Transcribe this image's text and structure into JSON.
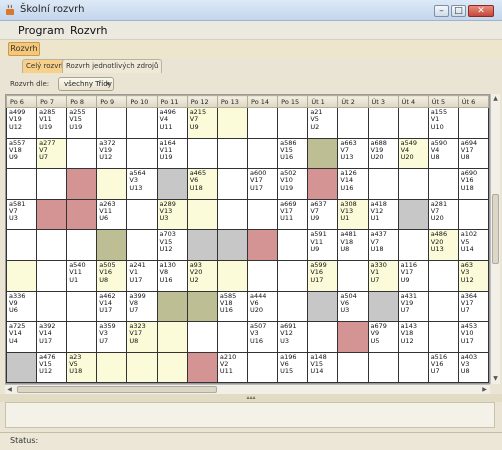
{
  "window": {
    "title": "Školní rozvrh"
  },
  "menu": [
    "Program",
    "Rozvrh"
  ],
  "toolbar": {
    "button": "Rozvrh"
  },
  "tabs": [
    "Celý rozvrh",
    "Rozvrh jednotlivých zdrojů"
  ],
  "filter": {
    "label": "Rozvrh dle:",
    "value": "všechny Třídy"
  },
  "grid": {
    "headers": [
      "Po 6",
      "Po 7",
      "Po 8",
      "Po 9",
      "Po 10",
      "Po 11",
      "Po 12",
      "Po 13",
      "Po 14",
      "Po 15",
      "Út 1",
      "Út 2",
      "Út 3",
      "Út 4",
      "Út 5",
      "Út 6"
    ],
    "rows": [
      [
        {
          "t": [
            "a499",
            "V19",
            "U12"
          ],
          "b": ""
        },
        {
          "t": [
            "a285",
            "V11",
            "U19"
          ],
          "b": ""
        },
        {
          "t": [
            "a255",
            "V15",
            "U19"
          ],
          "b": ""
        },
        {
          "t": [],
          "b": ""
        },
        {
          "t": [],
          "b": ""
        },
        {
          "t": [
            "a496",
            "V4",
            "U11"
          ],
          "b": ""
        },
        {
          "t": [
            "a215",
            "V7",
            "U9"
          ],
          "b": "y"
        },
        {
          "t": [],
          "b": "y"
        },
        {
          "t": [],
          "b": ""
        },
        {
          "t": [],
          "b": ""
        },
        {
          "t": [
            "a21",
            "V5",
            "U2"
          ],
          "b": ""
        },
        {
          "t": [],
          "b": ""
        },
        {
          "t": [],
          "b": ""
        },
        {
          "t": [],
          "b": ""
        },
        {
          "t": [
            "a155",
            "V1",
            "U10"
          ],
          "b": ""
        },
        {
          "t": [],
          "b": ""
        }
      ],
      [
        {
          "t": [
            "a557",
            "V18",
            "U9"
          ],
          "b": ""
        },
        {
          "t": [
            "a277",
            "V7",
            "U7"
          ],
          "b": "y"
        },
        {
          "t": [],
          "b": ""
        },
        {
          "t": [
            "a372",
            "V19",
            "U12"
          ],
          "b": ""
        },
        {
          "t": [],
          "b": ""
        },
        {
          "t": [
            "a164",
            "V11",
            "U19"
          ],
          "b": ""
        },
        {
          "t": [],
          "b": ""
        },
        {
          "t": [],
          "b": ""
        },
        {
          "t": [],
          "b": ""
        },
        {
          "t": [
            "a586",
            "V15",
            "U16"
          ],
          "b": ""
        },
        {
          "t": [],
          "b": "o"
        },
        {
          "t": [
            "a663",
            "V7",
            "U13"
          ],
          "b": ""
        },
        {
          "t": [
            "a688",
            "V19",
            "U20"
          ],
          "b": ""
        },
        {
          "t": [
            "a549",
            "V4",
            "U20"
          ],
          "b": "y"
        },
        {
          "t": [
            "a590",
            "V4",
            "U8"
          ],
          "b": ""
        },
        {
          "t": [
            "a694",
            "V17",
            "U8"
          ],
          "b": ""
        }
      ],
      [
        {
          "t": [],
          "b": ""
        },
        {
          "t": [],
          "b": ""
        },
        {
          "t": [],
          "b": "r"
        },
        {
          "t": [],
          "b": "y"
        },
        {
          "t": [
            "a564",
            "V3",
            "U13"
          ],
          "b": ""
        },
        {
          "t": [],
          "b": "g"
        },
        {
          "t": [
            "a465",
            "V6",
            "U18"
          ],
          "b": "y"
        },
        {
          "t": [],
          "b": ""
        },
        {
          "t": [
            "a600",
            "V17",
            "U17"
          ],
          "b": ""
        },
        {
          "t": [
            "a502",
            "V10",
            "U19"
          ],
          "b": ""
        },
        {
          "t": [],
          "b": "r"
        },
        {
          "t": [
            "a126",
            "V14",
            "U16"
          ],
          "b": ""
        },
        {
          "t": [],
          "b": ""
        },
        {
          "t": [],
          "b": ""
        },
        {
          "t": [],
          "b": ""
        },
        {
          "t": [
            "a690",
            "V16",
            "U18"
          ],
          "b": ""
        }
      ],
      [
        {
          "t": [
            "a581",
            "V7",
            "U3"
          ],
          "b": ""
        },
        {
          "t": [],
          "b": "r"
        },
        {
          "t": [],
          "b": "r"
        },
        {
          "t": [
            "a263",
            "V11",
            "U6"
          ],
          "b": ""
        },
        {
          "t": [],
          "b": ""
        },
        {
          "t": [
            "a289",
            "V13",
            "U3"
          ],
          "b": "y"
        },
        {
          "t": [],
          "b": "y"
        },
        {
          "t": [],
          "b": ""
        },
        {
          "t": [],
          "b": ""
        },
        {
          "t": [
            "a669",
            "V17",
            "U11"
          ],
          "b": ""
        },
        {
          "t": [
            "a637",
            "V7",
            "U9"
          ],
          "b": ""
        },
        {
          "t": [
            "a308",
            "V13",
            "U1"
          ],
          "b": "y"
        },
        {
          "t": [
            "a418",
            "V12",
            "U1"
          ],
          "b": ""
        },
        {
          "t": [],
          "b": "g"
        },
        {
          "t": [
            "a281",
            "V7",
            "U20"
          ],
          "b": ""
        },
        {
          "t": [],
          "b": ""
        }
      ],
      [
        {
          "t": [],
          "b": ""
        },
        {
          "t": [],
          "b": ""
        },
        {
          "t": [],
          "b": ""
        },
        {
          "t": [],
          "b": "o"
        },
        {
          "t": [],
          "b": ""
        },
        {
          "t": [
            "a703",
            "V15",
            "U12"
          ],
          "b": ""
        },
        {
          "t": [],
          "b": "g"
        },
        {
          "t": [],
          "b": "g"
        },
        {
          "t": [],
          "b": "r"
        },
        {
          "t": [],
          "b": ""
        },
        {
          "t": [
            "a591",
            "V11",
            "U9"
          ],
          "b": ""
        },
        {
          "t": [
            "a481",
            "V18",
            "U8"
          ],
          "b": ""
        },
        {
          "t": [
            "a437",
            "V7",
            "U18"
          ],
          "b": ""
        },
        {
          "t": [],
          "b": ""
        },
        {
          "t": [
            "a486",
            "V20",
            "U13"
          ],
          "b": "y"
        },
        {
          "t": [
            "a102",
            "V5",
            "U14"
          ],
          "b": ""
        }
      ],
      [
        {
          "t": [],
          "b": "y"
        },
        {
          "t": [],
          "b": ""
        },
        {
          "t": [
            "a540",
            "V11",
            "U1"
          ],
          "b": ""
        },
        {
          "t": [
            "a505",
            "V16",
            "U8"
          ],
          "b": "y"
        },
        {
          "t": [
            "a241",
            "V1",
            "U17"
          ],
          "b": ""
        },
        {
          "t": [
            "a130",
            "V8",
            "U16"
          ],
          "b": ""
        },
        {
          "t": [
            "a93",
            "V20",
            "U2"
          ],
          "b": "y"
        },
        {
          "t": [],
          "b": "y"
        },
        {
          "t": [],
          "b": ""
        },
        {
          "t": [],
          "b": ""
        },
        {
          "t": [
            "a599",
            "V16",
            "U17"
          ],
          "b": "y"
        },
        {
          "t": [],
          "b": ""
        },
        {
          "t": [
            "a330",
            "V1",
            "U7"
          ],
          "b": "y"
        },
        {
          "t": [
            "a116",
            "V17",
            "U9"
          ],
          "b": ""
        },
        {
          "t": [],
          "b": ""
        },
        {
          "t": [
            "a63",
            "V3",
            "U12"
          ],
          "b": "y"
        }
      ],
      [
        {
          "t": [
            "a336",
            "V9",
            "U6"
          ],
          "b": ""
        },
        {
          "t": [],
          "b": ""
        },
        {
          "t": [],
          "b": ""
        },
        {
          "t": [
            "a462",
            "V14",
            "U17"
          ],
          "b": ""
        },
        {
          "t": [
            "a399",
            "V8",
            "U7"
          ],
          "b": ""
        },
        {
          "t": [],
          "b": "o"
        },
        {
          "t": [],
          "b": "o"
        },
        {
          "t": [
            "a585",
            "V18",
            "U16"
          ],
          "b": ""
        },
        {
          "t": [
            "a444",
            "V6",
            "U20"
          ],
          "b": ""
        },
        {
          "t": [],
          "b": ""
        },
        {
          "t": [],
          "b": "g"
        },
        {
          "t": [
            "a504",
            "V6",
            "U3"
          ],
          "b": ""
        },
        {
          "t": [],
          "b": "g"
        },
        {
          "t": [
            "a431",
            "V19",
            "U7"
          ],
          "b": ""
        },
        {
          "t": [],
          "b": ""
        },
        {
          "t": [
            "a364",
            "V17",
            "U7"
          ],
          "b": ""
        }
      ],
      [
        {
          "t": [
            "a725",
            "V14",
            "U4"
          ],
          "b": ""
        },
        {
          "t": [
            "a392",
            "V14",
            "U17"
          ],
          "b": ""
        },
        {
          "t": [],
          "b": ""
        },
        {
          "t": [
            "a359",
            "V3",
            "U7"
          ],
          "b": ""
        },
        {
          "t": [
            "a323",
            "V17",
            "U8"
          ],
          "b": "y"
        },
        {
          "t": [],
          "b": "y"
        },
        {
          "t": [],
          "b": ""
        },
        {
          "t": [],
          "b": ""
        },
        {
          "t": [
            "a507",
            "V3",
            "U16"
          ],
          "b": ""
        },
        {
          "t": [
            "a691",
            "V12",
            "U3"
          ],
          "b": ""
        },
        {
          "t": [],
          "b": ""
        },
        {
          "t": [],
          "b": "r"
        },
        {
          "t": [
            "a679",
            "V9",
            "U5"
          ],
          "b": ""
        },
        {
          "t": [
            "a143",
            "V18",
            "U12"
          ],
          "b": ""
        },
        {
          "t": [],
          "b": ""
        },
        {
          "t": [
            "a453",
            "V10",
            "U17"
          ],
          "b": ""
        }
      ],
      [
        {
          "t": [],
          "b": "g"
        },
        {
          "t": [
            "a476",
            "V15",
            "U12"
          ],
          "b": ""
        },
        {
          "t": [
            "a23",
            "V5",
            "U18"
          ],
          "b": "y"
        },
        {
          "t": [],
          "b": "y"
        },
        {
          "t": [],
          "b": "y"
        },
        {
          "t": [],
          "b": "y"
        },
        {
          "t": [],
          "b": "r"
        },
        {
          "t": [
            "a210",
            "V2",
            "U11"
          ],
          "b": ""
        },
        {
          "t": [],
          "b": ""
        },
        {
          "t": [
            "a196",
            "V6",
            "U15"
          ],
          "b": ""
        },
        {
          "t": [
            "a148",
            "V15",
            "U14"
          ],
          "b": ""
        },
        {
          "t": [],
          "b": ""
        },
        {
          "t": [],
          "b": ""
        },
        {
          "t": [],
          "b": ""
        },
        {
          "t": [
            "a516",
            "V16",
            "U7"
          ],
          "b": ""
        },
        {
          "t": [
            "a403",
            "V3",
            "U8"
          ],
          "b": ""
        }
      ],
      [
        {
          "t": [],
          "b": ""
        },
        {
          "t": [],
          "b": ""
        },
        {
          "t": [
            "a380"
          ],
          "b": "y"
        },
        {
          "t": [],
          "b": ""
        },
        {
          "t": [],
          "b": ""
        },
        {
          "t": [],
          "b": ""
        },
        {
          "t": [],
          "b": ""
        },
        {
          "t": [],
          "b": "r"
        },
        {
          "t": [],
          "b": ""
        },
        {
          "t": [
            "a188"
          ],
          "b": ""
        },
        {
          "t": [
            "a305"
          ],
          "b": ""
        },
        {
          "t": [],
          "b": ""
        },
        {
          "t": [],
          "b": ""
        },
        {
          "t": [],
          "b": ""
        },
        {
          "t": [],
          "b": ""
        },
        {
          "t": [],
          "b": ""
        }
      ]
    ]
  },
  "status": {
    "label": "Status:"
  },
  "icons": {
    "app": "coffee-cup-icon",
    "minimize": "minimize-icon",
    "maximize": "maximize-icon",
    "close": "close-icon"
  }
}
